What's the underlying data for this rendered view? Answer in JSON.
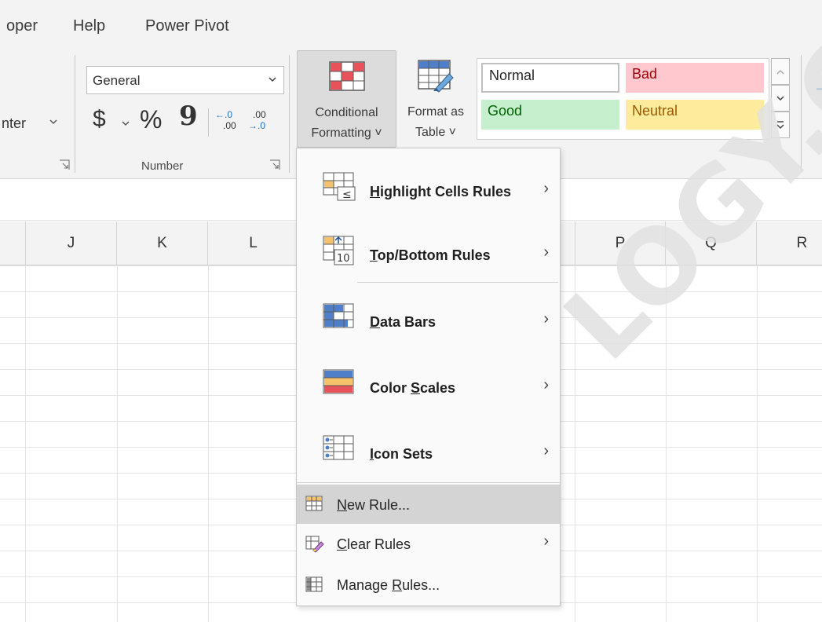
{
  "ribbon_tabs": [
    "oper",
    "Help",
    "Power Pivot"
  ],
  "alignment": {
    "merge_fragment": "nter"
  },
  "number": {
    "format_value": "General",
    "currency_symbol": "$",
    "percent_symbol": "%",
    "comma_symbol": "9",
    "increase_decimal_top": "←.0",
    "increase_decimal_bottom": ".00",
    "decrease_decimal_top": ".00",
    "decrease_decimal_bottom": "→.0",
    "group_label": "Number"
  },
  "styles_group": {
    "conditional_formatting_line1": "Conditional",
    "conditional_formatting_line2": "Formatting ˅",
    "format_as_table_line1": "Format as",
    "format_as_table_line2": "Table ˅",
    "cells": [
      {
        "label": "Normal",
        "bg": "#ffffff",
        "fg": "#000000"
      },
      {
        "label": "Bad",
        "bg": "#ffc7ce",
        "fg": "#9c0006"
      },
      {
        "label": "Good",
        "bg": "#c6efce",
        "fg": "#006100"
      },
      {
        "label": "Neutral",
        "bg": "#ffeb9c",
        "fg": "#9c5700"
      }
    ]
  },
  "columns": [
    "J",
    "K",
    "L",
    "P",
    "Q",
    "R"
  ],
  "menu": {
    "items": [
      {
        "pre": "",
        "ul": "H",
        "post": "ighlight Cells Rules",
        "icon": "highlight-cells-icon",
        "submenu": true
      },
      {
        "pre": "",
        "ul": "T",
        "post": "op/Bottom Rules",
        "icon": "top-bottom-icon",
        "submenu": true
      },
      {
        "pre": "",
        "ul": "D",
        "post": "ata Bars",
        "icon": "data-bars-icon",
        "submenu": true
      },
      {
        "pre": "Color ",
        "ul": "S",
        "post": "cales",
        "icon": "color-scales-icon",
        "submenu": true
      },
      {
        "pre": "",
        "ul": "I",
        "post": "con Sets",
        "icon": "icon-sets-icon",
        "submenu": true
      },
      {
        "pre": "",
        "ul": "N",
        "post": "ew Rule...",
        "icon": "new-rule-icon",
        "submenu": false,
        "highlighted": true
      },
      {
        "pre": "",
        "ul": "C",
        "post": "lear Rules",
        "icon": "clear-rules-icon",
        "submenu": true
      },
      {
        "pre": "Manage ",
        "ul": "R",
        "post": "ules...",
        "icon": "manage-rules-icon",
        "submenu": false
      }
    ],
    "arrow": "›",
    "top_bottom_icon_number": "10"
  },
  "watermark": "LOGY.CO",
  "colors": {
    "menu_highlight": "#d4d4d4",
    "ribbon_bg": "#f3f3f3",
    "cf_button_bg": "#dcdcdc"
  }
}
